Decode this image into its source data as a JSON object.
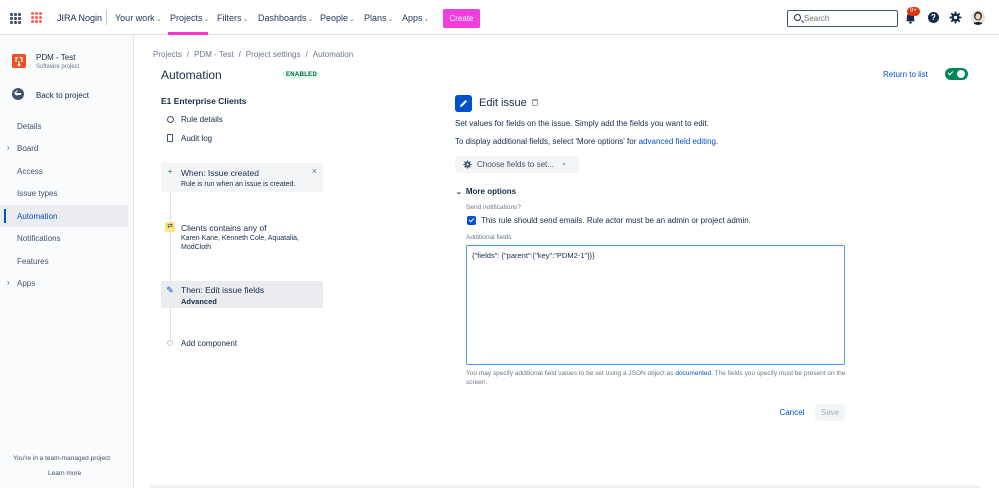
{
  "topnav": {
    "brand": "JIRA Nogin",
    "items": [
      {
        "label": "Your work",
        "chev": "⌄"
      },
      {
        "label": "Projects",
        "chev": "⌄"
      },
      {
        "label": "Filters",
        "chev": "⌄"
      },
      {
        "label": "Dashboards",
        "chev": "⌄"
      },
      {
        "label": "People",
        "chev": "⌄"
      },
      {
        "label": "Plans",
        "chev": "⌄"
      },
      {
        "label": "Apps",
        "chev": "⌄"
      }
    ],
    "create_label": "Create",
    "search_placeholder": "Search",
    "notifications_badge": "9+",
    "help_glyph": "?",
    "accent_color": "#f03edc"
  },
  "sidebar": {
    "project_name": "PDM - Test",
    "project_type": "Software project",
    "back_label": "Back to project",
    "items": [
      {
        "label": "Details",
        "arrow": ""
      },
      {
        "label": "Board",
        "arrow": "›"
      },
      {
        "label": "Access",
        "arrow": ""
      },
      {
        "label": "Issue types",
        "arrow": ""
      },
      {
        "label": "Automation",
        "arrow": "",
        "active": true
      },
      {
        "label": "Notifications",
        "arrow": ""
      },
      {
        "label": "Features",
        "arrow": ""
      },
      {
        "label": "Apps",
        "arrow": "›"
      }
    ],
    "footer_text": "You're in a team-managed project",
    "footer_link": "Learn more"
  },
  "breadcrumb": [
    "Projects",
    "PDM - Test",
    "Project settings",
    "Automation"
  ],
  "breadcrumb_sep": "/",
  "page": {
    "title": "Automation",
    "status": "ENABLED",
    "return_label": "Return to list"
  },
  "rule": {
    "name": "E1 Enterprise Clients",
    "links": [
      "Rule details",
      "Audit log"
    ],
    "components": [
      {
        "type": "trigger",
        "icon": "+",
        "close": "×",
        "title": "When: Issue created",
        "sub": "Rule is run when an issue is created."
      },
      {
        "type": "condition",
        "icon": "⇄",
        "title": "Clients contains any of",
        "sub": "Karen Kane, Kenneth Cole, Aquatalia, ModCloth"
      },
      {
        "type": "action",
        "icon": "✎",
        "title": "Then: Edit issue fields",
        "sub": "Advanced"
      }
    ],
    "add_component": "Add component"
  },
  "editor": {
    "title": "Edit issue",
    "desc1": "Set values for fields on the issue. Simply add the fields you want to edit.",
    "desc2_prefix": "To display additional fields, select 'More options' for ",
    "desc2_link": "advanced field editing",
    "desc2_suffix": ".",
    "choose_label": "Choose fields to set...",
    "choose_chev": "⌄",
    "more_options": "More options",
    "more_chev": "⌄",
    "send_label": "Send notifications?",
    "send_checkbox": "This rule should send emails. Rule actor must be an admin or project admin.",
    "additional_label": "Additional fields",
    "additional_value": "{\"fields\": {\"parent\":{\"key\":\"PDM2-1\"}}}",
    "help_prefix": "You may specify additional field values to be set using a JSON object as ",
    "help_link": "documented",
    "help_suffix": ". The fields you specify must be present on the screen.",
    "cancel": "Cancel",
    "save": "Save"
  }
}
